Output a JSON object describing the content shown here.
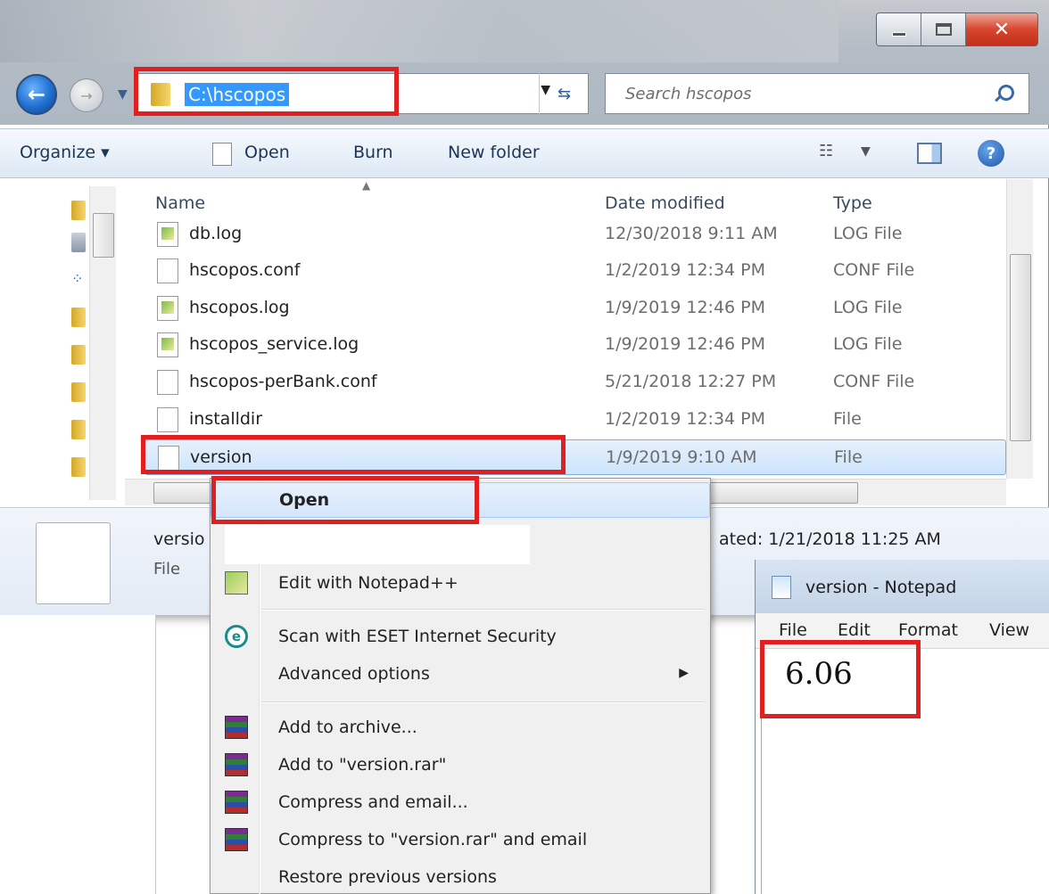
{
  "explorer": {
    "address": "C:\\hscopos",
    "search_placeholder": "Search hscopos",
    "toolbar": {
      "organize": "Organize ▾",
      "open": "Open",
      "burn": "Burn",
      "new_folder": "New folder"
    },
    "columns": {
      "name": "Name",
      "date": "Date modified",
      "type": "Type"
    },
    "files": [
      {
        "name": "db.log",
        "date": "12/30/2018 9:11 AM",
        "type": "LOG File",
        "icon": "log-file-icon"
      },
      {
        "name": "hscopos.conf",
        "date": "1/2/2019 12:34 PM",
        "type": "CONF File",
        "icon": "file-icon"
      },
      {
        "name": "hscopos.log",
        "date": "1/9/2019 12:46 PM",
        "type": "LOG File",
        "icon": "log-file-icon"
      },
      {
        "name": "hscopos_service.log",
        "date": "1/9/2019 12:46 PM",
        "type": "LOG File",
        "icon": "log-file-icon"
      },
      {
        "name": "hscopos-perBank.conf",
        "date": "5/21/2018 12:27 PM",
        "type": "CONF File",
        "icon": "file-icon"
      },
      {
        "name": "installdir",
        "date": "1/2/2019 12:34 PM",
        "type": "File",
        "icon": "file-icon"
      },
      {
        "name": "version",
        "date": "1/9/2019 9:10 AM",
        "type": "File",
        "icon": "file-icon",
        "selected": true
      }
    ],
    "details": {
      "name": "versio",
      "type": "File",
      "created": "ated: 1/21/2018 11:25 AM"
    }
  },
  "context_menu": {
    "items": [
      {
        "label": "Open",
        "bold": true
      },
      {
        "label": "Edit with Notepad++",
        "icon": "notepad-plus-plus-icon"
      },
      {
        "label": "Scan with ESET Internet Security",
        "icon": "eset-icon"
      },
      {
        "label": "Advanced options",
        "submenu": true
      },
      {
        "label": "Add to archive...",
        "icon": "winrar-icon"
      },
      {
        "label": "Add to \"version.rar\"",
        "icon": "winrar-icon"
      },
      {
        "label": "Compress and email...",
        "icon": "winrar-icon"
      },
      {
        "label": "Compress to \"version.rar\" and email",
        "icon": "winrar-icon"
      },
      {
        "label": "Restore previous versions"
      }
    ]
  },
  "notepad": {
    "title": "version - Notepad",
    "menu": [
      "File",
      "Edit",
      "Format",
      "View"
    ],
    "content": "6.06"
  },
  "colors": {
    "highlight_red": "#e02020",
    "selection_blue": "#3399ff"
  }
}
